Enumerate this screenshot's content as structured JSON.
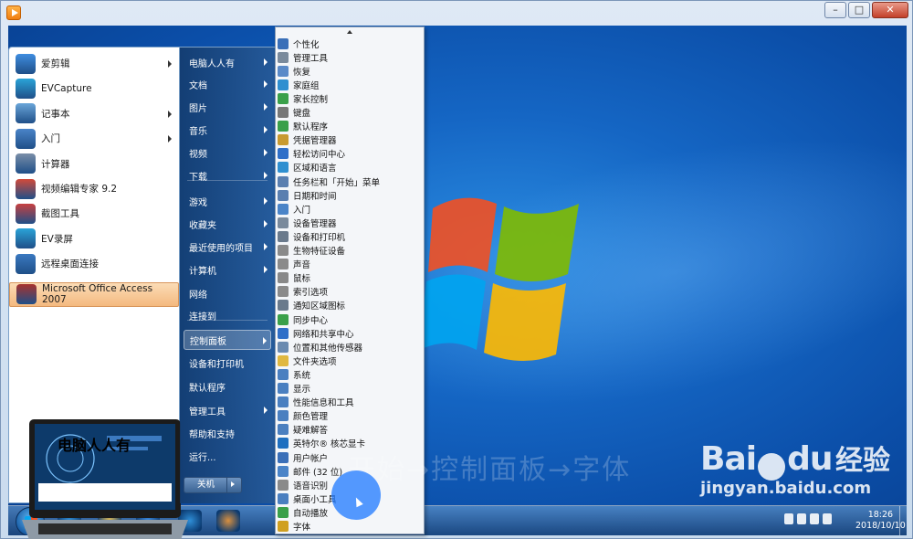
{
  "window": {
    "minimize": "–",
    "maximize": "□",
    "close": "✕"
  },
  "start_menu": {
    "programs": [
      {
        "label": "爱剪辑",
        "icon": "aijianji-icon",
        "has_arrow": true,
        "color": "#3f8de0"
      },
      {
        "label": "EVCapture",
        "icon": "evcapture-icon",
        "has_arrow": false,
        "color": "#2aa4d8"
      },
      {
        "label": "记事本",
        "icon": "notepad-icon",
        "has_arrow": true,
        "color": "#6aa6d9"
      },
      {
        "label": "入门",
        "icon": "getting-started-icon",
        "has_arrow": true,
        "color": "#4a84c8"
      },
      {
        "label": "计算器",
        "icon": "calculator-icon",
        "has_arrow": false,
        "color": "#7a8ea8"
      },
      {
        "label": "视频编辑专家 9.2",
        "icon": "video-editor-icon",
        "has_arrow": false,
        "color": "#d24a3a"
      },
      {
        "label": "截图工具",
        "icon": "snipping-tool-icon",
        "has_arrow": false,
        "color": "#c84040"
      },
      {
        "label": "EV录屏",
        "icon": "ev-recorder-icon",
        "has_arrow": false,
        "color": "#2aa4d8"
      },
      {
        "label": "远程桌面连接",
        "icon": "remote-desktop-icon",
        "has_arrow": false,
        "color": "#3a79c0"
      },
      {
        "label": "Microsoft Office Access 2007",
        "icon": "access-icon",
        "has_arrow": false,
        "color": "#a8322e"
      }
    ],
    "laptop_caption": "电脑人人有",
    "right_items": [
      {
        "label": "电脑人人有",
        "has_arrow": true
      },
      {
        "label": "文档",
        "has_arrow": true
      },
      {
        "label": "图片",
        "has_arrow": true
      },
      {
        "label": "音乐",
        "has_arrow": true
      },
      {
        "label": "视频",
        "has_arrow": true
      },
      {
        "label": "下载",
        "has_arrow": true
      },
      {
        "label": "游戏",
        "has_arrow": true
      },
      {
        "label": "收藏夹",
        "has_arrow": true
      },
      {
        "label": "最近使用的项目",
        "has_arrow": true
      },
      {
        "label": "计算机",
        "has_arrow": true
      },
      {
        "label": "网络",
        "has_arrow": false
      },
      {
        "label": "连接到",
        "has_arrow": false
      },
      {
        "label": "控制面板",
        "has_arrow": true
      },
      {
        "label": "设备和打印机",
        "has_arrow": false
      },
      {
        "label": "默认程序",
        "has_arrow": false
      },
      {
        "label": "管理工具",
        "has_arrow": true
      },
      {
        "label": "帮助和支持",
        "has_arrow": false
      },
      {
        "label": "运行...",
        "has_arrow": false
      }
    ],
    "shutdown_label": "关机"
  },
  "control_panel": {
    "items": [
      {
        "label": "个性化",
        "color": "#3a6fb8"
      },
      {
        "label": "管理工具",
        "color": "#7a8a9c"
      },
      {
        "label": "恢复",
        "color": "#5a8ac8"
      },
      {
        "label": "家庭组",
        "color": "#2f8fd0"
      },
      {
        "label": "家长控制",
        "color": "#3aa04a"
      },
      {
        "label": "键盘",
        "color": "#777777"
      },
      {
        "label": "默认程序",
        "color": "#3aa04a"
      },
      {
        "label": "凭据管理器",
        "color": "#c89a30"
      },
      {
        "label": "轻松访问中心",
        "color": "#2f6fc8"
      },
      {
        "label": "区域和语言",
        "color": "#2f8fd0"
      },
      {
        "label": "任务栏和「开始」菜单",
        "color": "#5a7fb0"
      },
      {
        "label": "日期和时间",
        "color": "#5a7fb0"
      },
      {
        "label": "入门",
        "color": "#4a84c8"
      },
      {
        "label": "设备管理器",
        "color": "#7a8a9c"
      },
      {
        "label": "设备和打印机",
        "color": "#6a7a8c"
      },
      {
        "label": "生物特征设备",
        "color": "#8a8a8a"
      },
      {
        "label": "声音",
        "color": "#8a8a8a"
      },
      {
        "label": "鼠标",
        "color": "#888888"
      },
      {
        "label": "索引选项",
        "color": "#8a8a8a"
      },
      {
        "label": "通知区域图标",
        "color": "#6a7a8c"
      },
      {
        "label": "同步中心",
        "color": "#3aa04a"
      },
      {
        "label": "网络和共享中心",
        "color": "#2f6fc8"
      },
      {
        "label": "位置和其他传感器",
        "color": "#6a8ab0"
      },
      {
        "label": "文件夹选项",
        "color": "#e0b840"
      },
      {
        "label": "系统",
        "color": "#4a7fc0"
      },
      {
        "label": "显示",
        "color": "#4a7fc0"
      },
      {
        "label": "性能信息和工具",
        "color": "#4a7fc0"
      },
      {
        "label": "颜色管理",
        "color": "#4a7fc0"
      },
      {
        "label": "疑难解答",
        "color": "#4a7fc0"
      },
      {
        "label": "英特尔® 核芯显卡",
        "color": "#1e6fc0"
      },
      {
        "label": "用户帐户",
        "color": "#3a6fb8"
      },
      {
        "label": "邮件 (32 位)",
        "color": "#4a84c8"
      },
      {
        "label": "语音识别",
        "color": "#8a8a8a"
      },
      {
        "label": "桌面小工具",
        "color": "#4a7fc0"
      },
      {
        "label": "自动播放",
        "color": "#3aa04a"
      },
      {
        "label": "字体",
        "color": "#d0a020"
      }
    ]
  },
  "taskbar": {
    "pinned": [
      {
        "icon": "ie-icon",
        "color": "#2f8fd8"
      },
      {
        "icon": "explorer-icon",
        "color": "#e8c050"
      },
      {
        "icon": "media-player-icon",
        "color": "#3a8ae0"
      },
      {
        "icon": "ie-alt-icon",
        "color": "#2f8fd8"
      },
      {
        "icon": "paint-icon",
        "color": "#d89040"
      }
    ],
    "time": "18:26",
    "date": "2018/10/10"
  },
  "watermark": {
    "path_text": "开始→控制面板→字体",
    "brand": "Bai",
    "brand2": "du",
    "jingyan": "经验",
    "url": "jingyan.baidu.com"
  }
}
